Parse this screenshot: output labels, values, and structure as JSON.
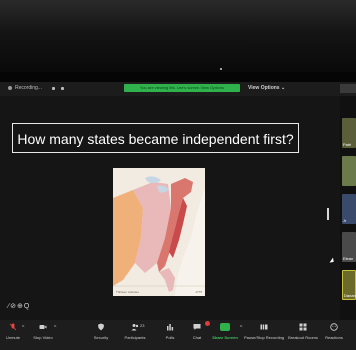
{
  "window": {
    "recording_label": "Recording...",
    "share_banner_text": "You are viewing Ms. Lee's screen  View Options",
    "view_options_label": "View Options ⌄"
  },
  "slide": {
    "caption": "How many states became independent first?"
  },
  "map": {
    "footer_left": "Thirteen colonies",
    "footer_right": "1775"
  },
  "zoom_mark": "∕⊘⊕Q",
  "participants": [
    {
      "label": "Patri"
    },
    {
      "label": ""
    },
    {
      "label": "Jr"
    },
    {
      "label": "Elean"
    },
    {
      "label": "Danan"
    }
  ],
  "toolbar": {
    "mute_label": "Unmute",
    "video_label": "Stop Video",
    "security_label": "Security",
    "participants_label": "Participants",
    "participants_count": "23",
    "polls_label": "Polls",
    "chat_label": "Chat",
    "share_label": "Share Screen",
    "record_label": "Pause/Stop Recording",
    "breakout_label": "Breakout Rooms",
    "reactions_label": "Reactions"
  },
  "colors": {
    "share_green": "#2fb24c",
    "background": "#151515",
    "toolbar": "#1d1d1d"
  }
}
